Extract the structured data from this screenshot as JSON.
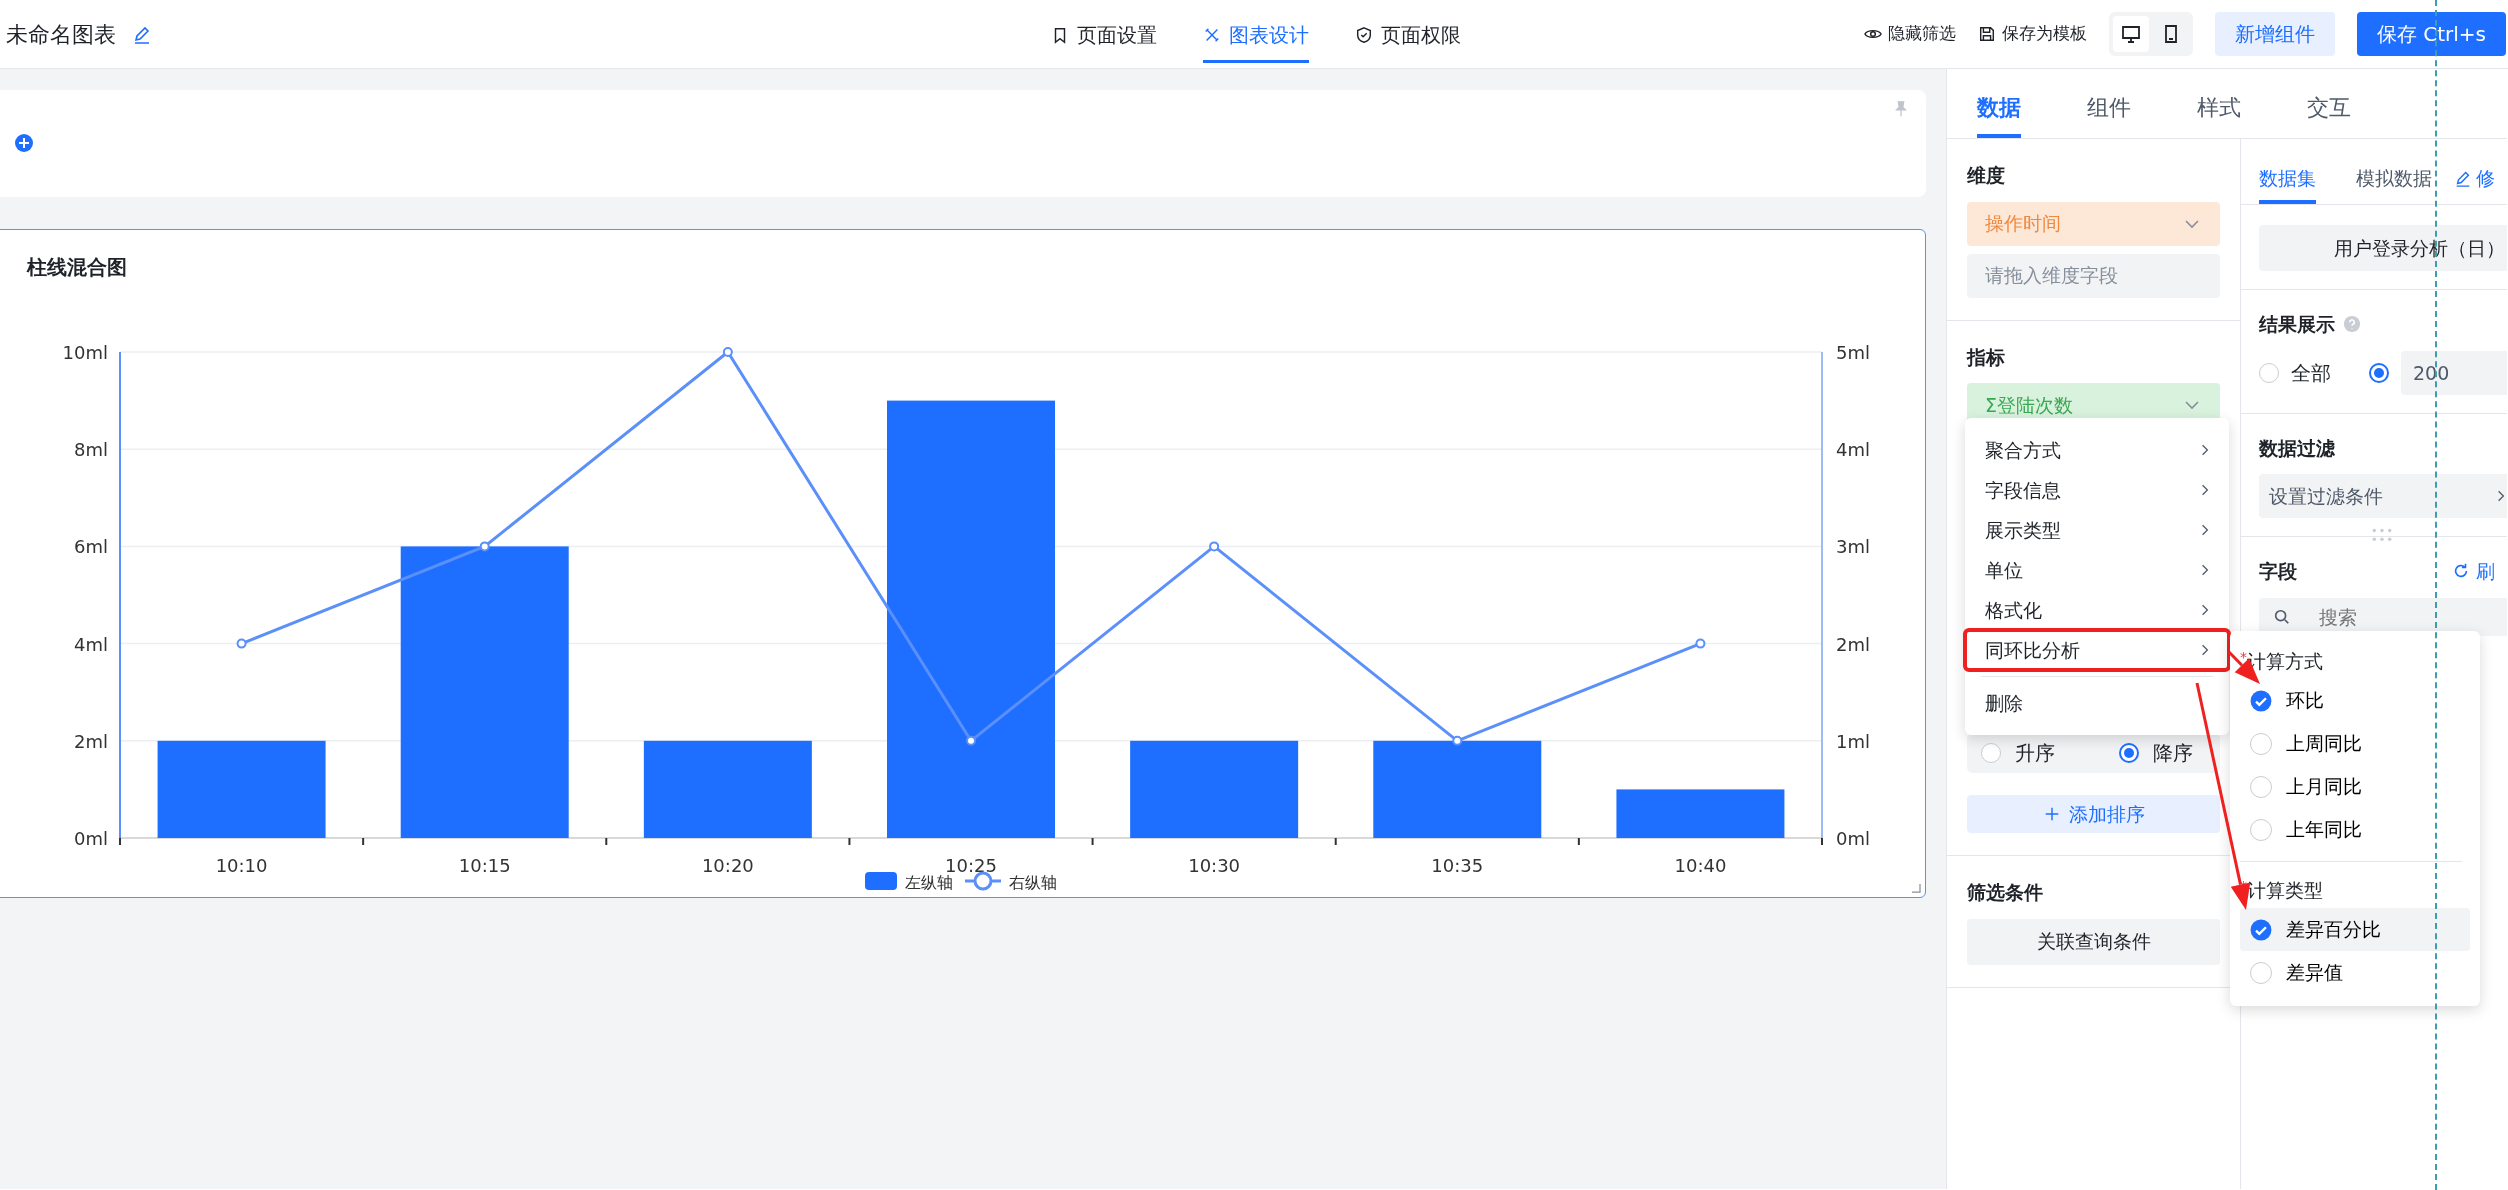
{
  "header": {
    "title": "未命名图表",
    "tabs": [
      {
        "label": "页面设置",
        "selected": false
      },
      {
        "label": "图表设计",
        "selected": true
      },
      {
        "label": "页面权限",
        "selected": false
      }
    ],
    "actions": [
      {
        "label": "隐藏筛选"
      },
      {
        "label": "保存为模板"
      }
    ],
    "view_toggle": [
      {
        "kind": "desktop",
        "selected": true
      },
      {
        "kind": "mobile",
        "selected": false
      }
    ],
    "buttons": [
      {
        "label": "新增组件",
        "kind": "secondary"
      },
      {
        "label": "保存 Ctrl+s",
        "kind": "primary"
      }
    ]
  },
  "chart_card": {
    "title": "柱线混合图",
    "selected": true,
    "chart_data": {
      "type": "bar",
      "categories": [
        "10:10",
        "10:15",
        "10:20",
        "10:25",
        "10:30",
        "10:35",
        "10:40"
      ],
      "series": [
        {
          "name": "左纵轴",
          "color": "#1e6fff",
          "type": "bar",
          "values": [
            2,
            6,
            2,
            9,
            2,
            2,
            1
          ]
        },
        {
          "name": "右纵轴",
          "color": "#5b8ff9",
          "type": "line",
          "axis": "y2",
          "marker": "o",
          "values": [
            2,
            3,
            5,
            1,
            3,
            1,
            2
          ]
        }
      ],
      "grid": true,
      "legend": "bottom",
      "ylim": [
        0,
        10
      ],
      "yticks": [
        {
          "value": 0,
          "label": "0ml"
        },
        {
          "value": 2,
          "label": "2ml"
        },
        {
          "value": 4,
          "label": "4ml"
        },
        {
          "value": 6,
          "label": "6ml"
        },
        {
          "value": 8,
          "label": "8ml"
        },
        {
          "value": 10,
          "label": "10ml"
        }
      ],
      "y2lim": [
        0,
        5
      ],
      "y2ticks": [
        {
          "value": 0,
          "label": "0ml"
        },
        {
          "value": 1,
          "label": "1ml"
        },
        {
          "value": 2,
          "label": "2ml"
        },
        {
          "value": 3,
          "label": "3ml"
        },
        {
          "value": 4,
          "label": "4ml"
        },
        {
          "value": 5,
          "label": "5ml"
        }
      ]
    }
  },
  "panel_tabs": [
    {
      "label": "数据",
      "selected": true
    },
    {
      "label": "组件",
      "selected": false
    },
    {
      "label": "样式",
      "selected": false
    },
    {
      "label": "交互",
      "selected": false
    }
  ],
  "dimension": {
    "title": "维度",
    "field": "操作时间",
    "placeholder": "请拖入维度字段"
  },
  "metric": {
    "title": "指标",
    "field": "Σ登陆次数"
  },
  "sort": {
    "options": [
      {
        "label": "升序",
        "selected": false
      },
      {
        "label": "降序",
        "selected": true
      }
    ],
    "add_button": "添加排序"
  },
  "filter": {
    "title": "筛选条件",
    "button": "关联查询条件"
  },
  "data_source": {
    "tabs": [
      {
        "label": "数据集",
        "selected": true
      },
      {
        "label": "模拟数据",
        "selected": false
      }
    ],
    "edit_link": "修",
    "dataset": "用户登录分析（日）",
    "result": {
      "title": "结果展示",
      "options": [
        {
          "kind": "radio",
          "label": "全部",
          "selected": false
        },
        {
          "kind": "input",
          "value": "200",
          "selected": true
        }
      ]
    },
    "data_filter": {
      "title": "数据过滤",
      "button": "设置过滤条件"
    },
    "fields": {
      "title": "字段",
      "refresh": "刷",
      "search_placeholder": "搜索"
    }
  },
  "context_menu": {
    "items": [
      {
        "label": "聚合方式",
        "kind": "submenu",
        "annotated": false
      },
      {
        "label": "字段信息",
        "kind": "submenu",
        "annotated": false
      },
      {
        "label": "展示类型",
        "kind": "submenu",
        "annotated": false
      },
      {
        "label": "单位",
        "kind": "submenu",
        "annotated": false
      },
      {
        "label": "格式化",
        "kind": "submenu",
        "annotated": false
      },
      {
        "label": "同环比分析",
        "kind": "submenu",
        "annotated": true
      },
      {
        "label": "删除",
        "kind": "action",
        "annotated": false
      }
    ]
  },
  "submenu": {
    "groups": [
      {
        "marker": "*",
        "title": "计算方式",
        "options": [
          {
            "label": "环比",
            "selected": true,
            "hovered": false
          },
          {
            "label": "上周同比",
            "selected": false,
            "hovered": false
          },
          {
            "label": "上月同比",
            "selected": false,
            "hovered": false
          },
          {
            "label": "上年同比",
            "selected": false,
            "hovered": false
          }
        ]
      },
      {
        "marker": "*",
        "title": "计算类型",
        "options": [
          {
            "label": "差异百分比",
            "selected": true,
            "hovered": true
          },
          {
            "label": "差异值",
            "selected": false,
            "hovered": false
          }
        ]
      }
    ]
  }
}
